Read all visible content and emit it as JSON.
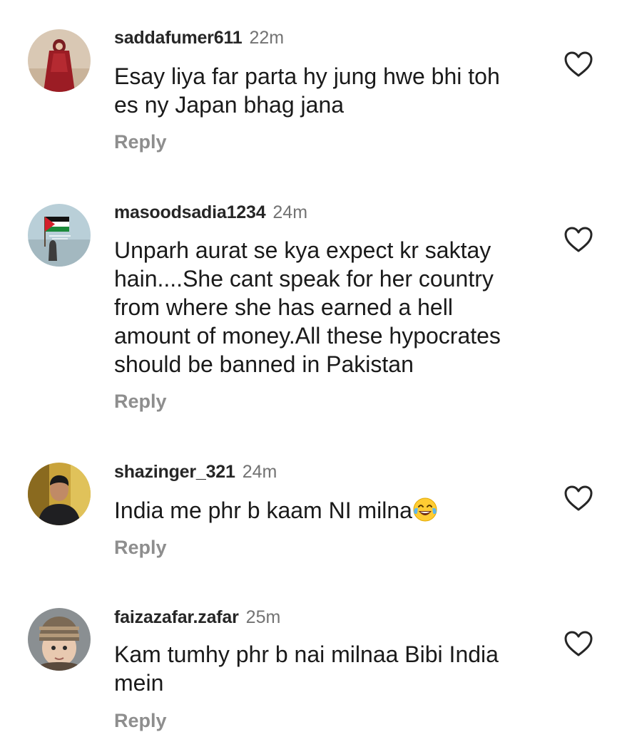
{
  "comments": [
    {
      "username": "saddafumer611",
      "time": "22m",
      "text": "Esay liya far parta hy jung hwe bhi toh\nes ny Japan bhag jana",
      "reply_label": "Reply",
      "avatar_icon": "avatar-woman-red-dress",
      "like_icon": "heart-outline-icon"
    },
    {
      "username": "masoodsadia1234",
      "time": "24m",
      "text": "Unparh aurat se kya expect kr saktay\nhain....She cant speak for her country\nfrom where she has earned a hell\namount of money.All these hypocrates\nshould be banned in Pakistan",
      "reply_label": "Reply",
      "avatar_icon": "avatar-palestine-flag",
      "like_icon": "heart-outline-icon"
    },
    {
      "username": "shazinger_321",
      "time": "24m",
      "text": "India me phr b kaam NI milna",
      "emoji": "face-with-tears-of-joy",
      "reply_label": "Reply",
      "avatar_icon": "avatar-man-black-jacket",
      "like_icon": "heart-outline-icon"
    },
    {
      "username": "faizazafar.zafar",
      "time": "25m",
      "text": "Kam tumhy phr b nai milnaa Bibi India\nmein",
      "reply_label": "Reply",
      "avatar_icon": "avatar-child-knit-hat",
      "like_icon": "heart-outline-icon"
    }
  ],
  "colors": {
    "text": "#1a1a1a",
    "username": "#262626",
    "muted": "#737373",
    "reply": "#8e8e8e"
  }
}
